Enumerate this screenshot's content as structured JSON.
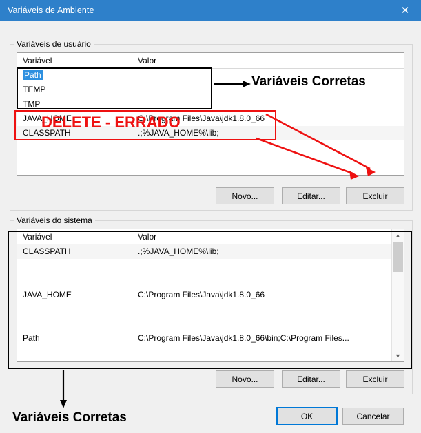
{
  "window": {
    "title": "Variáveis de Ambiente",
    "close_icon": "close-icon",
    "titlebar_color": "#2e80ca"
  },
  "user_section": {
    "label": "Variáveis de usuário",
    "columns": {
      "name": "Variável",
      "value": "Valor"
    },
    "rows": [
      {
        "name": "Path",
        "value": "",
        "selected": true
      },
      {
        "name": "TEMP",
        "value": "",
        "selected": false
      },
      {
        "name": "TMP",
        "value": "",
        "selected": false
      },
      {
        "name": "JAVA_HOME",
        "value": "C:\\Program Files\\Java\\jdk1.8.0_66",
        "selected": false
      },
      {
        "name": "CLASSPATH",
        "value": ".;%JAVA_HOME%\\lib;",
        "selected": false
      }
    ],
    "buttons": {
      "new": "Novo...",
      "edit": "Editar...",
      "delete": "Excluir"
    }
  },
  "system_section": {
    "label": "Variáveis do sistema",
    "columns": {
      "name": "Variável",
      "value": "Valor"
    },
    "rows": [
      {
        "name": "CLASSPATH",
        "value": ".;%JAVA_HOME%\\lib;"
      },
      {
        "name": "",
        "value": ""
      },
      {
        "name": "",
        "value": ""
      },
      {
        "name": "JAVA_HOME",
        "value": "C:\\Program Files\\Java\\jdk1.8.0_66"
      },
      {
        "name": "",
        "value": ""
      },
      {
        "name": "",
        "value": ""
      },
      {
        "name": "Path",
        "value": "C:\\Program Files\\Java\\jdk1.8.0_66\\bin;C:\\Program Files..."
      }
    ],
    "buttons": {
      "new": "Novo...",
      "edit": "Editar...",
      "delete": "Excluir"
    },
    "scrollbar": {
      "up_icon": "chevron-up-icon",
      "down_icon": "chevron-down-icon"
    }
  },
  "dialog_buttons": {
    "ok": "OK",
    "cancel": "Cancelar"
  },
  "annotations": {
    "correct_top": "Variáveis Corretas",
    "wrong": "DELETE - ERRADO",
    "correct_bottom": "Variáveis Corretas",
    "red_color": "#ee1111",
    "black_color": "#000000"
  }
}
